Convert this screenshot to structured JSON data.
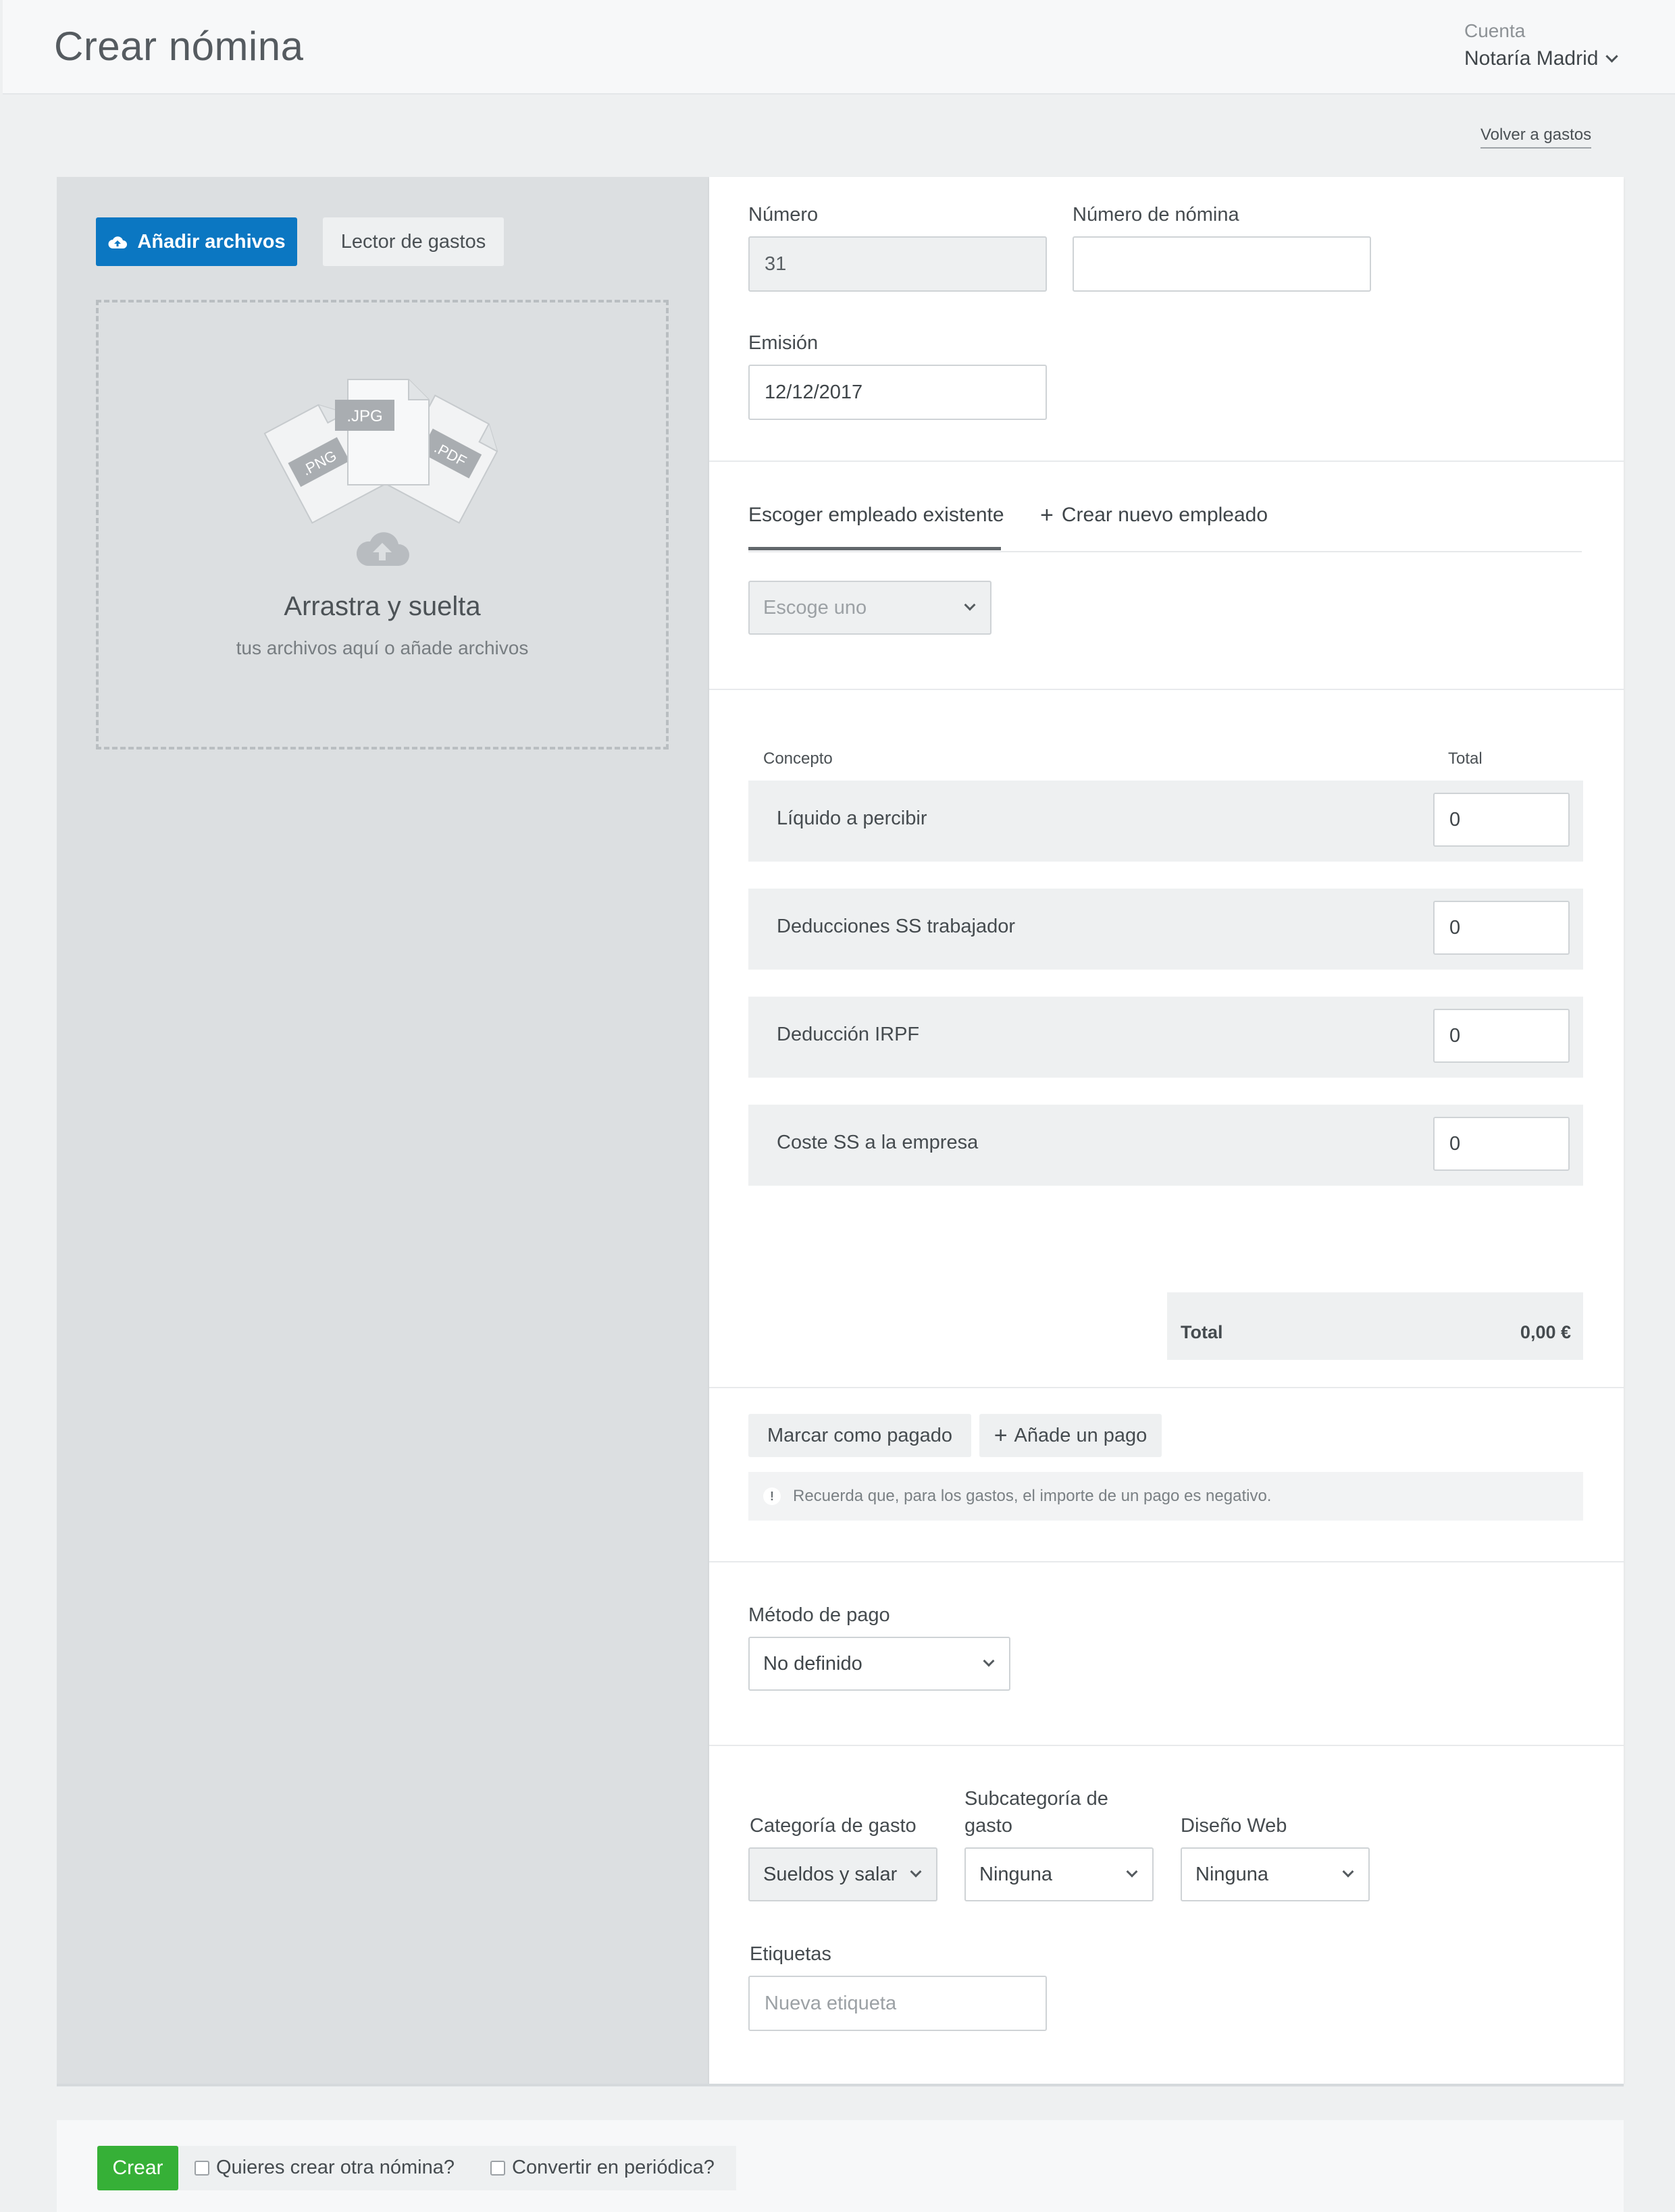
{
  "header": {
    "title": "Crear nómina",
    "account_label": "Cuenta",
    "account_value": "Notaría Madrid",
    "back_link": "Volver a gastos"
  },
  "upload": {
    "add_files_label": "Añadir archivos",
    "reader_label": "Lector de gastos",
    "drop_title": "Arrastra y suelta",
    "drop_subtitle": "tus archivos aquí o añade archivos",
    "file_tags": [
      ".PNG",
      ".JPG",
      ".PDF"
    ]
  },
  "form": {
    "number_label": "Número",
    "number_value": "31",
    "payroll_number_label": "Número de nómina",
    "payroll_number_value": "",
    "issue_label": "Emisión",
    "issue_value": "12/12/2017",
    "tabs": {
      "existing": "Escoger empleado existente",
      "new": "Crear nuevo empleado"
    },
    "employee_select": "Escoge uno",
    "concept_header": "Concepto",
    "total_header": "Total",
    "concepts": [
      {
        "label": "Líquido a percibir",
        "value": "0"
      },
      {
        "label": "Deducciones SS trabajador",
        "value": "0"
      },
      {
        "label": "Deducción IRPF",
        "value": "0"
      },
      {
        "label": "Coste SS a la empresa",
        "value": "0"
      }
    ],
    "total_label": "Total",
    "total_value": "0,00 €",
    "mark_paid": "Marcar como pagado",
    "add_payment": "Añade un pago",
    "notice_icon": "!",
    "notice": "Recuerda que, para los gastos, el importe de un pago es negativo.",
    "payment_method_label": "Método de pago",
    "payment_method_value": "No definido",
    "category_label": "Categoría de gasto",
    "category_value": "Sueldos y salar",
    "subcategory_label_1": "Subcategoría de",
    "subcategory_label_2": "gasto",
    "subcategory_value": "Ninguna",
    "design_label": "Diseño Web",
    "design_value": "Ninguna",
    "tags_label": "Etiquetas",
    "tags_placeholder": "Nueva etiqueta"
  },
  "footer": {
    "create": "Crear",
    "another": "Quieres crear otra nómina?",
    "periodic": "Convertir en periódica?"
  },
  "colors": {
    "primary": "#0b77c2",
    "create": "#36b037"
  }
}
